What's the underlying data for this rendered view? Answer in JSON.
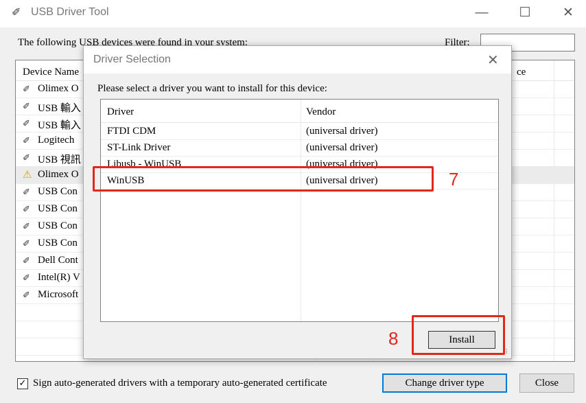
{
  "window": {
    "title": "USB Driver Tool",
    "app_icon": "usb-plug-icon",
    "minimize": "—",
    "maximize": "☐",
    "close": "✕"
  },
  "main": {
    "found_label": "The following USB devices were found in your system:",
    "filter_label": "Filter:",
    "filter_value": "",
    "columns": {
      "name": "Device Name",
      "right": "ce"
    },
    "devices": [
      {
        "name": "Olimex O",
        "icon": "usb-plug-icon"
      },
      {
        "name": "USB 輸入",
        "icon": "usb-plug-icon"
      },
      {
        "name": "USB 輸入",
        "icon": "usb-plug-icon"
      },
      {
        "name": "Logitech",
        "icon": "usb-plug-icon"
      },
      {
        "name": "USB 視訊",
        "icon": "usb-plug-icon"
      },
      {
        "name": "Olimex O",
        "icon": "warning-icon"
      },
      {
        "name": "USB Con",
        "icon": "usb-plug-icon"
      },
      {
        "name": "USB Con",
        "icon": "usb-plug-icon"
      },
      {
        "name": "USB Con",
        "icon": "usb-plug-icon"
      },
      {
        "name": "USB Con",
        "icon": "usb-plug-icon"
      },
      {
        "name": "Dell Cont",
        "icon": "usb-plug-icon"
      },
      {
        "name": "Intel(R) V",
        "icon": "usb-plug-icon"
      },
      {
        "name": "Microsoft",
        "icon": "usb-plug-icon"
      }
    ]
  },
  "footer": {
    "sign_checked": true,
    "sign_label": "Sign auto-generated drivers with a temporary auto-generated certificate",
    "change_driver_label": "Change driver type",
    "close_label": "Close"
  },
  "dialog": {
    "title": "Driver Selection",
    "close": "✕",
    "prompt": "Please select a driver you want to install for this device:",
    "columns": {
      "driver": "Driver",
      "vendor": "Vendor"
    },
    "drivers": [
      {
        "name": "FTDI CDM",
        "vendor": "(universal driver)"
      },
      {
        "name": "ST-Link Driver",
        "vendor": "(universal driver)"
      },
      {
        "name": "Libusb - WinUSB",
        "vendor": "(universal driver)"
      },
      {
        "name": "WinUSB",
        "vendor": "(universal driver)"
      }
    ],
    "install_label": "Install"
  },
  "annotations": {
    "step7": "7",
    "step8": "8",
    "color": "#e0281d"
  }
}
